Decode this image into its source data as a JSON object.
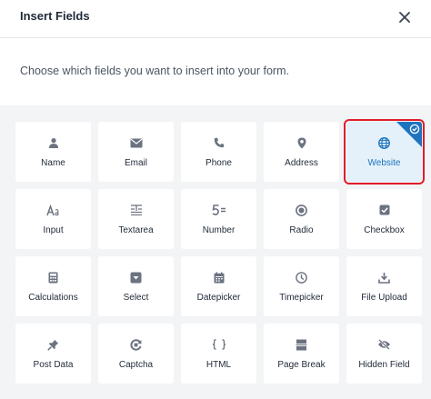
{
  "dialog": {
    "title": "Insert Fields",
    "description": "Choose which fields you want to insert into your form."
  },
  "fields": [
    {
      "label": "Name",
      "icon": "person-icon"
    },
    {
      "label": "Email",
      "icon": "envelope-icon"
    },
    {
      "label": "Phone",
      "icon": "phone-icon"
    },
    {
      "label": "Address",
      "icon": "map-pin-icon"
    },
    {
      "label": "Website",
      "icon": "globe-icon",
      "selected": true
    },
    {
      "label": "Input",
      "icon": "text-input-icon"
    },
    {
      "label": "Textarea",
      "icon": "textarea-icon"
    },
    {
      "label": "Number",
      "icon": "number-icon"
    },
    {
      "label": "Radio",
      "icon": "radio-icon"
    },
    {
      "label": "Checkbox",
      "icon": "checkbox-icon"
    },
    {
      "label": "Calculations",
      "icon": "calculator-icon"
    },
    {
      "label": "Select",
      "icon": "select-icon"
    },
    {
      "label": "Datepicker",
      "icon": "calendar-icon"
    },
    {
      "label": "Timepicker",
      "icon": "clock-icon"
    },
    {
      "label": "File Upload",
      "icon": "upload-icon"
    },
    {
      "label": "Post Data",
      "icon": "pin-icon"
    },
    {
      "label": "Captcha",
      "icon": "captcha-icon"
    },
    {
      "label": "HTML",
      "icon": "code-braces-icon"
    },
    {
      "label": "Page Break",
      "icon": "page-break-icon"
    },
    {
      "label": "Hidden Field",
      "icon": "eye-slash-icon"
    }
  ],
  "colors": {
    "icon_gray": "#6b7280",
    "accent_blue": "#1e73be",
    "selected_bg": "#e4f1fb",
    "highlight_red": "#e11d2a"
  }
}
